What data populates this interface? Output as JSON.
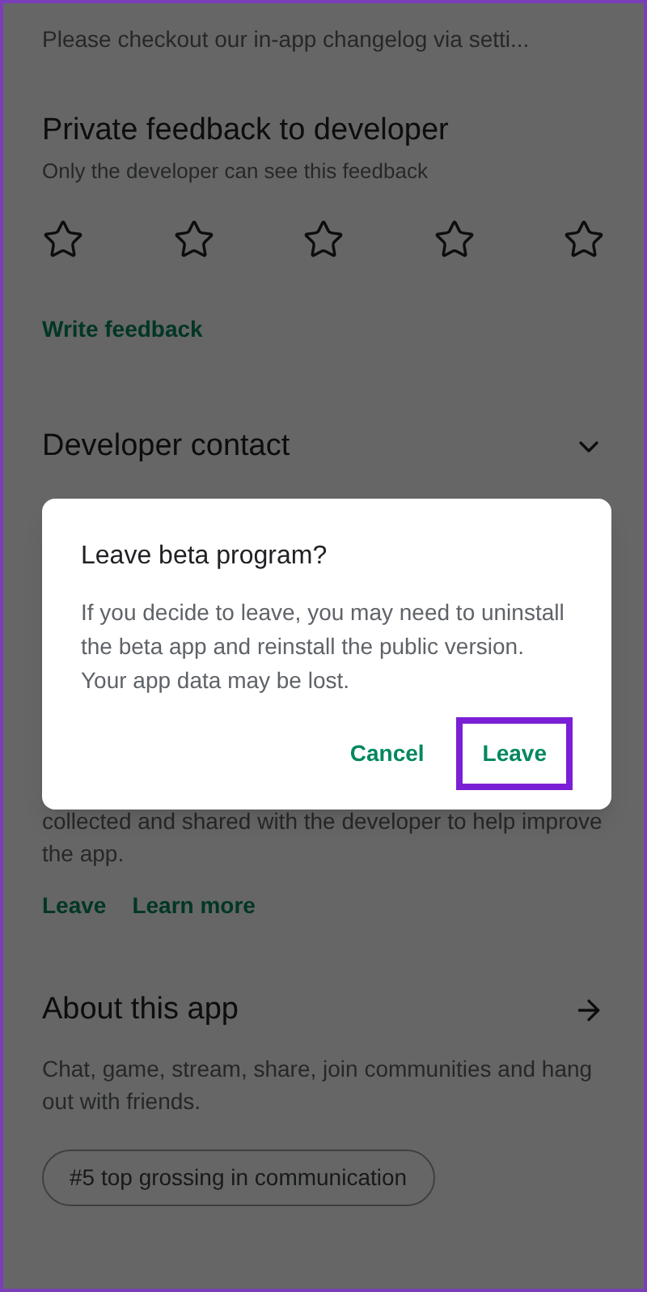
{
  "whats_new": {
    "text": "Please checkout our in-app changelog via setti..."
  },
  "private_feedback": {
    "title": "Private feedback to developer",
    "subtitle": "Only the developer can see this feedback",
    "stars": 0,
    "link": "Write feedback"
  },
  "developer_contact": {
    "title": "Developer contact",
    "expanded": false
  },
  "beta": {
    "text": "collected and shared with the developer to help improve the app.",
    "links": [
      "Leave",
      "Learn more"
    ]
  },
  "about": {
    "title": "About this app",
    "description": "Chat, game, stream, share, join communities and hang out with friends.",
    "chip": "#5 top grossing in communication"
  },
  "dialog": {
    "title": "Leave beta program?",
    "message": "If you decide to leave, you may need to uninstall the beta app and reinstall the public version. Your app data may be lost.",
    "buttons": [
      {
        "label": "Cancel",
        "highlighted": false
      },
      {
        "label": "Leave",
        "highlighted": true
      }
    ]
  }
}
